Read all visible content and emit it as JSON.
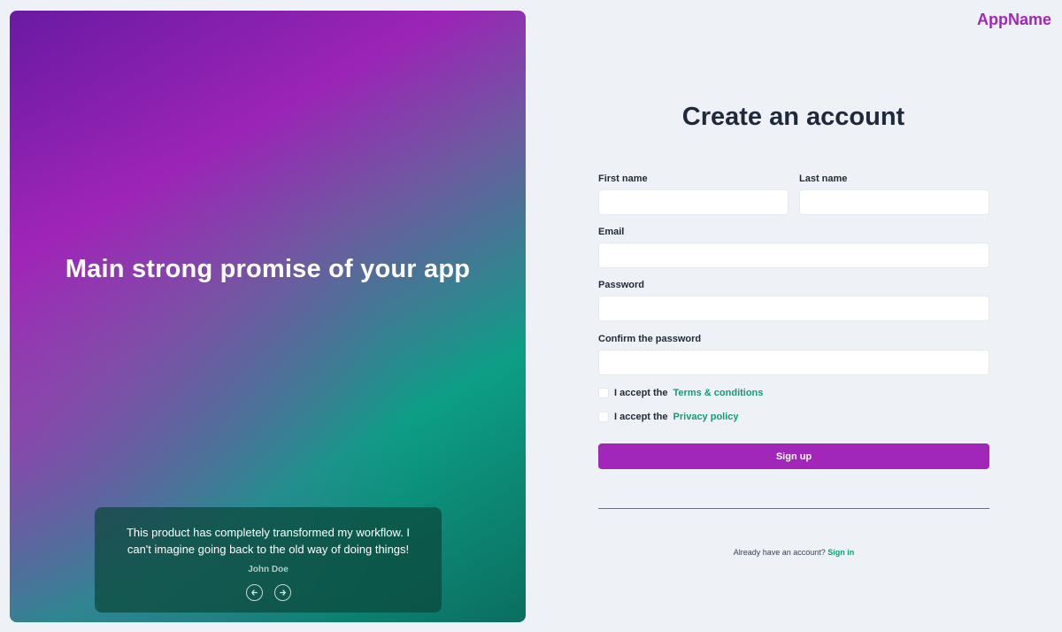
{
  "brand": {
    "name": "AppName",
    "color": "#a127b8"
  },
  "hero": {
    "title": "Main strong promise of your app",
    "testimonial": {
      "quote": "This product has completely transformed my workflow. I can't imagine going back to the old way of doing things!",
      "author": "John Doe"
    },
    "nav": {
      "prev_icon": "arrow-left-circle-icon",
      "next_icon": "arrow-right-circle-icon"
    }
  },
  "form": {
    "title": "Create an account",
    "first_name": {
      "label": "First name",
      "value": ""
    },
    "last_name": {
      "label": "Last name",
      "value": ""
    },
    "email": {
      "label": "Email",
      "value": ""
    },
    "password": {
      "label": "Password",
      "value": ""
    },
    "confirm_password": {
      "label": "Confirm the password",
      "value": ""
    },
    "terms": {
      "prefix": "I accept the",
      "link": "Terms & conditions",
      "checked": false
    },
    "privacy": {
      "prefix": "I accept the",
      "link": "Privacy policy",
      "checked": false
    },
    "submit_label": "Sign up",
    "signin_prompt": "Already have an account?",
    "signin_link": "Sign in"
  },
  "colors": {
    "accent": "#a127b8",
    "link": "#159a78",
    "background": "#eef2f7"
  }
}
